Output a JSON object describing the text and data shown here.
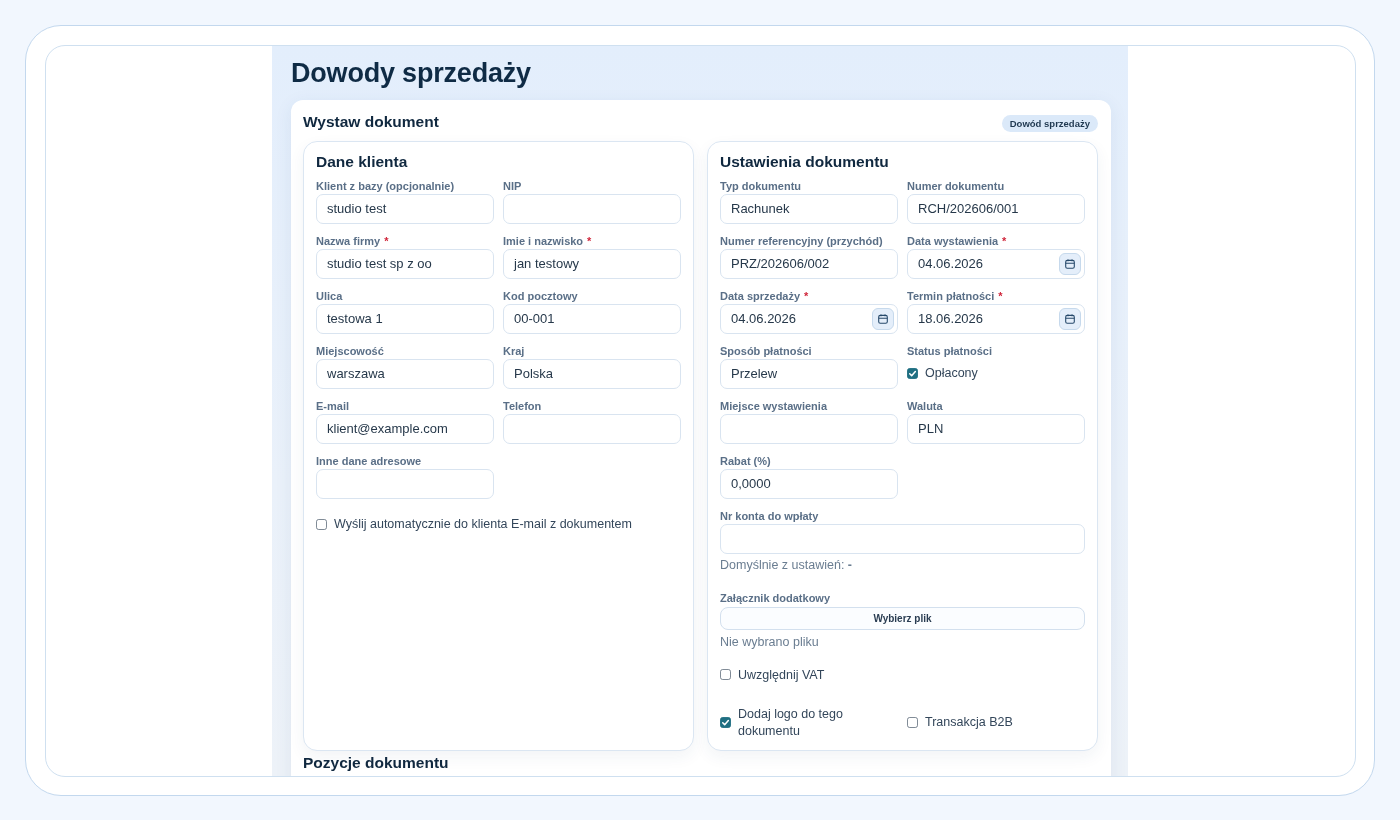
{
  "page": {
    "title": "Dowody sprzedaży"
  },
  "card": {
    "title": "Wystaw dokument",
    "badge": "Dowód sprzedaży"
  },
  "client_panel": {
    "title": "Dane klienta",
    "fields": [
      {
        "label": "Klient z bazy (opcjonalnie)",
        "value": "studio test"
      },
      {
        "label": "NIP"
      },
      {
        "label": "Nazwa firmy",
        "required_mark": "*",
        "value": "studio test sp z oo"
      },
      {
        "label": "Imie i nazwisko",
        "required_mark": "*",
        "value": "jan testowy"
      },
      {
        "label": "Ulica",
        "value": "testowa 1"
      },
      {
        "label": "Kod pocztowy",
        "value": "00-001"
      },
      {
        "label": "Miejscowość",
        "value": "warszawa"
      },
      {
        "label": "Kraj",
        "value": "Polska"
      },
      {
        "label": "E-mail",
        "value": "klient@example.com"
      },
      {
        "label": "Telefon"
      },
      {
        "label": "Inne dane adresowe"
      }
    ],
    "checkboxes": [
      {
        "label": "Wyślij automatycznie do klienta E-mail z dokumentem",
        "checked": false
      }
    ]
  },
  "document_panel": {
    "title": "Ustawienia dokumentu",
    "fields": [
      {
        "kind": "text",
        "label": "Typ dokumentu",
        "value": "Rachunek"
      },
      {
        "kind": "text",
        "label": "Numer dokumentu",
        "value": "RCH/202606/001"
      },
      {
        "kind": "text",
        "label": "Numer referencyjny (przychód)",
        "value": "PRZ/202606/002"
      },
      {
        "kind": "date",
        "label": "Data wystawienia",
        "required_mark": "*",
        "value": "04.06.2026"
      },
      {
        "kind": "date",
        "label": "Data sprzedaży",
        "required_mark": "*",
        "value": "04.06.2026"
      },
      {
        "kind": "date",
        "label": "Termin płatności",
        "required_mark": "*",
        "value": "18.06.2026"
      },
      {
        "kind": "text",
        "label": "Sposób płatności",
        "value": "Przelew"
      },
      {
        "kind": "check",
        "label": "Status płatności",
        "option": "Opłacony",
        "checked": true
      },
      {
        "kind": "text",
        "label": "Miejsce wystawienia"
      },
      {
        "kind": "text",
        "label": "Waluta",
        "value": "PLN"
      },
      {
        "kind": "text",
        "label": "Rabat (%)",
        "value": "0,0000"
      },
      {
        "kind": "wide",
        "label": "Nr konta do wpłaty",
        "hint": "Domyślnie z ustawień: **-**"
      },
      {
        "kind": "file",
        "label": "Załącznik dodatkowy",
        "button": "Wybierz plik",
        "status": "Nie wybrano pliku"
      }
    ],
    "option_rows": [
      [
        {
          "label": "Uwzględnij VAT",
          "checked": false
        }
      ],
      [
        {
          "label": "Dodaj logo do tego dokumentu",
          "checked": true
        },
        {
          "label": "Transakcja B2B",
          "checked": false
        }
      ]
    ]
  },
  "next_section": {
    "title": "Pozycje dokumentu"
  }
}
